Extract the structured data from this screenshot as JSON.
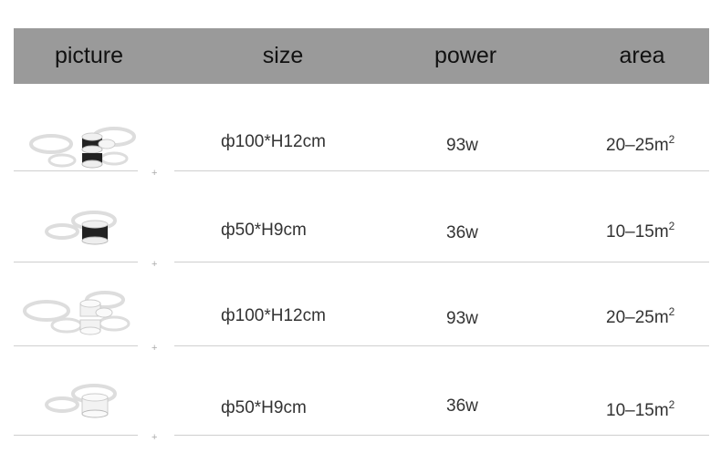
{
  "header": {
    "picture": "picture",
    "size": "size",
    "power": "power",
    "area": "area"
  },
  "rows": [
    {
      "size": "ф100*H12cm",
      "power": "93w",
      "area_value": "20–25m",
      "area_unit_exp": "2",
      "image": "six-ring-black-ceiling-light"
    },
    {
      "size": "ф50*H9cm",
      "power": "36w",
      "area_value": "10–15m",
      "area_unit_exp": "2",
      "image": "three-ring-black-ceiling-light"
    },
    {
      "size": "ф100*H12cm",
      "power": "93w",
      "area_value": "20–25m",
      "area_unit_exp": "2",
      "image": "six-ring-white-ceiling-light"
    },
    {
      "size": "ф50*H9cm",
      "power": "36w",
      "area_value": "10–15m",
      "area_unit_exp": "2",
      "image": "three-ring-white-ceiling-light"
    }
  ],
  "separator_symbol": "+"
}
